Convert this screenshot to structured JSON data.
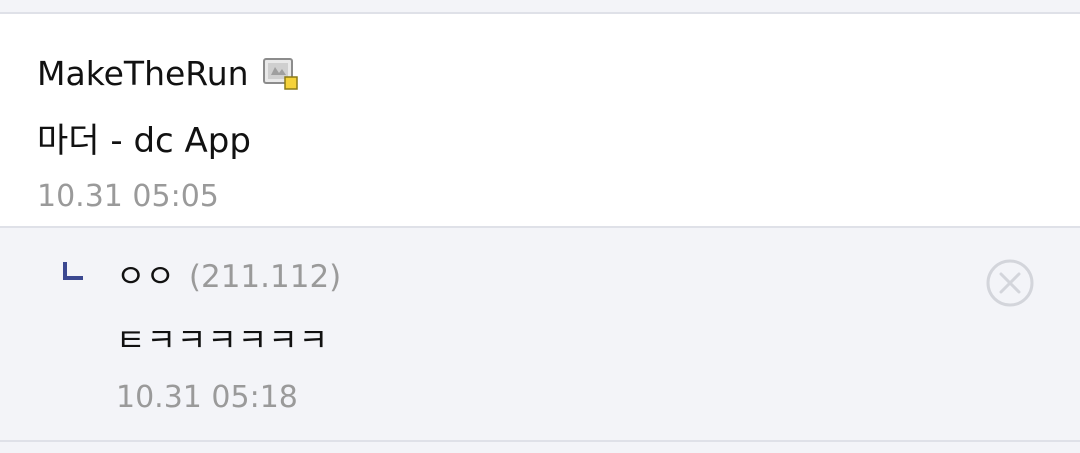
{
  "comment": {
    "author": "MakeTheRun",
    "author_badge_icon": "gallog-badge-icon",
    "text": "마더 - dc App",
    "time": "10.31 05:05"
  },
  "reply": {
    "arrow_icon": "reply-arrow-icon",
    "author": "ㅇㅇ",
    "ip": "(211.112)",
    "text": "ㅌㅋㅋㅋㅋㅋㅋ",
    "time": "10.31 05:18",
    "delete_icon": "delete-circle-icon"
  },
  "colors": {
    "background": "#f3f4f8",
    "text": "#111111",
    "muted": "#9a9a9a",
    "accent": "#3b4890",
    "divider": "#dfe1e8"
  }
}
